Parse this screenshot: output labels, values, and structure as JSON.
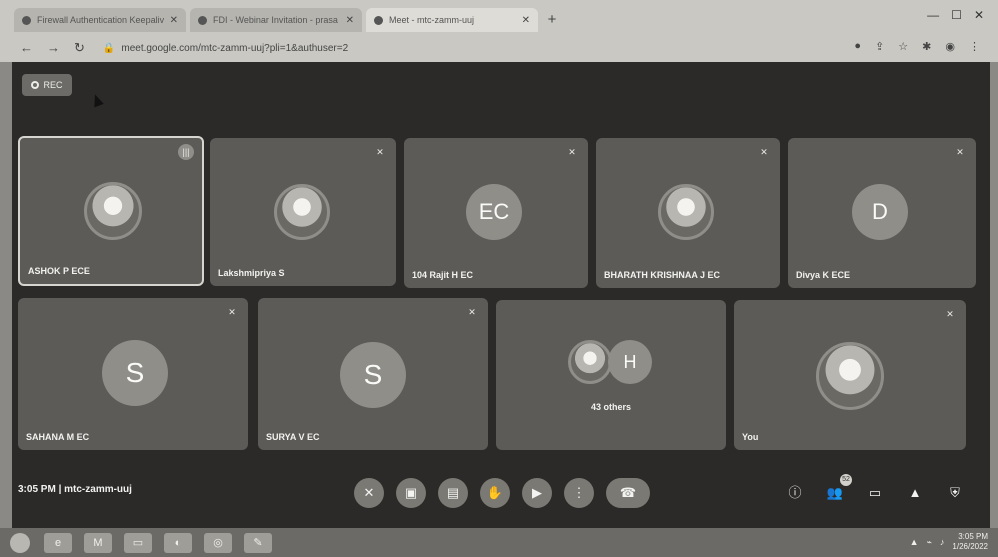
{
  "browser": {
    "tabs": [
      {
        "title": "Firewall Authentication Keepalive",
        "active": false
      },
      {
        "title": "FDI - Webinar Invitation - prasa",
        "active": false
      },
      {
        "title": "Meet - mtc-zamm-uuj",
        "active": true
      }
    ],
    "url": "meet.google.com/mtc-zamm-uuj?pli=1&authuser=2"
  },
  "meet": {
    "rec_label": "REC",
    "participants": [
      {
        "name": "ASHOK P ECE",
        "avatar": "photo",
        "initials": "",
        "speaking": true
      },
      {
        "name": "Lakshmipriya S",
        "avatar": "photo",
        "initials": "",
        "speaking": false
      },
      {
        "name": "104 Rajit H EC",
        "avatar": "initials",
        "initials": "EC",
        "speaking": false
      },
      {
        "name": "BHARATH KRISHNAA J EC",
        "avatar": "photo",
        "initials": "",
        "speaking": false
      },
      {
        "name": "Divya K ECE",
        "avatar": "initials",
        "initials": "D",
        "speaking": false
      },
      {
        "name": "SAHANA M EC",
        "avatar": "initials",
        "initials": "S",
        "speaking": false
      },
      {
        "name": "SURYA V EC",
        "avatar": "initials",
        "initials": "S",
        "speaking": false
      },
      {
        "name": "",
        "avatar": "group",
        "initials": "H",
        "others_label": "43 others",
        "speaking": false
      },
      {
        "name": "You",
        "avatar": "photo",
        "initials": "",
        "speaking": false
      }
    ],
    "meeting_info": "3:05 PM  |  mtc-zamm-uuj",
    "people_count": "52",
    "controls": [
      "mic-off",
      "camera-off",
      "captions",
      "raise-hand",
      "present",
      "more-options",
      "leave-call"
    ],
    "right_controls": [
      "meeting-details",
      "people",
      "chat",
      "activities",
      "host-controls"
    ]
  },
  "taskbar": {
    "clock_time": "3:05 PM",
    "clock_date": "1/26/2022"
  }
}
